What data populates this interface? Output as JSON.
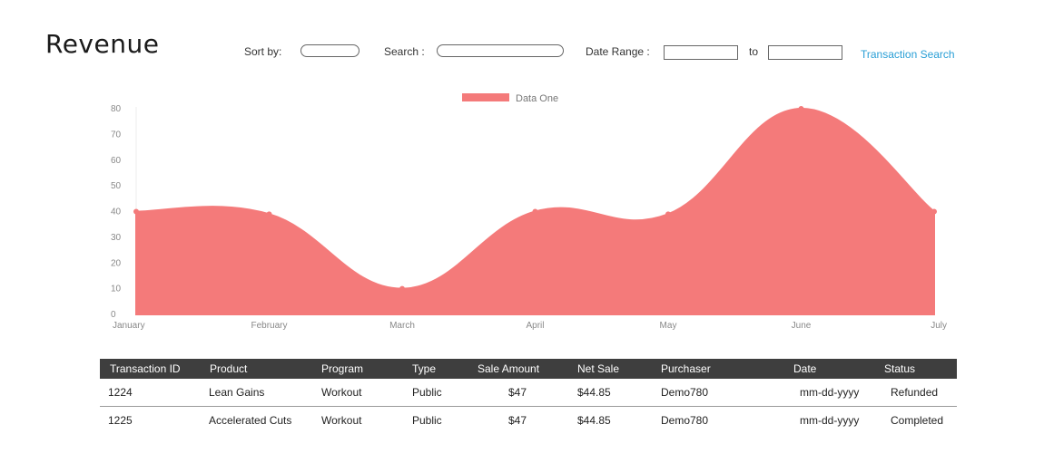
{
  "page": {
    "title": "Revenue"
  },
  "filters": {
    "sort_label": "Sort by:",
    "sort_value": "",
    "search_label": "Search :",
    "search_value": "",
    "date_range_label": "Date Range :",
    "date_from": "",
    "to_label": "to",
    "date_to": "",
    "search_link": "Transaction Search"
  },
  "chart_data": {
    "type": "area",
    "title": "",
    "xlabel": "",
    "ylabel": "",
    "categories": [
      "January",
      "February",
      "March",
      "April",
      "May",
      "June",
      "July"
    ],
    "series": [
      {
        "name": "Data One",
        "values": [
          40,
          39,
          10,
          40,
          39,
          80,
          40
        ]
      }
    ],
    "ylim": [
      0,
      80
    ],
    "yticks": [
      0,
      10,
      20,
      30,
      40,
      50,
      60,
      70,
      80
    ],
    "grid": false,
    "legend_position": "top-center",
    "color": "#f47a7a"
  },
  "table": {
    "columns": [
      "Transaction ID",
      "Product",
      "Program",
      "Type",
      "Sale Amount",
      "Net Sale",
      "Purchaser",
      "Date",
      "Status"
    ],
    "rows": [
      [
        "1224",
        "Lean Gains",
        "Workout",
        "Public",
        "$47",
        "$44.85",
        "Demo780",
        "mm-dd-yyyy",
        "Refunded"
      ],
      [
        "1225",
        "Accelerated Cuts",
        "Workout",
        "Public",
        "$47",
        "$44.85",
        "Demo780",
        "mm-dd-yyyy",
        "Completed"
      ]
    ]
  }
}
